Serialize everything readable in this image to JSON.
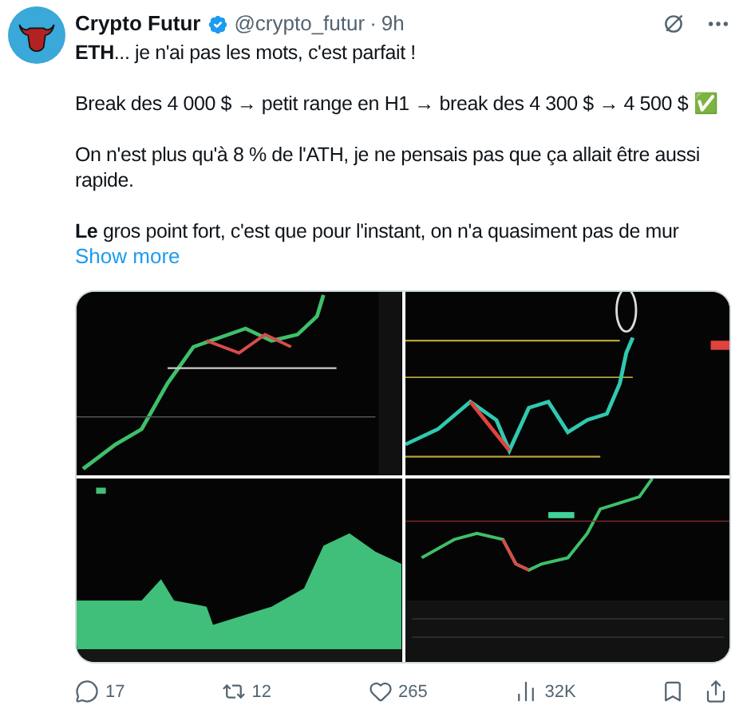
{
  "post": {
    "author": "Crypto Futur",
    "verified": true,
    "handle": "@crypto_futur",
    "separator": "·",
    "time": "9h",
    "paragraphs": [
      "**ETH**... je n'ai pas les mots, c'est parfait !",
      "Break des 4 000 $ → petit range en H1 → break des 4 300 $ → 4 500 $ ✅",
      "On n'est plus qu'à 8 % de l'ATH, je ne pensais pas que ça allait être aussi rapide.",
      "**Le** gros point fort, c'est que pour l'instant, on n'a quasiment pas de mur"
    ],
    "show_more": "Show more",
    "actions": [
      {
        "kind": "reply",
        "count": "17"
      },
      {
        "kind": "repost",
        "count": "12"
      },
      {
        "kind": "like",
        "count": "265"
      },
      {
        "kind": "views",
        "count": "32K"
      },
      {
        "kind": "bookmark"
      },
      {
        "kind": "share"
      }
    ]
  }
}
